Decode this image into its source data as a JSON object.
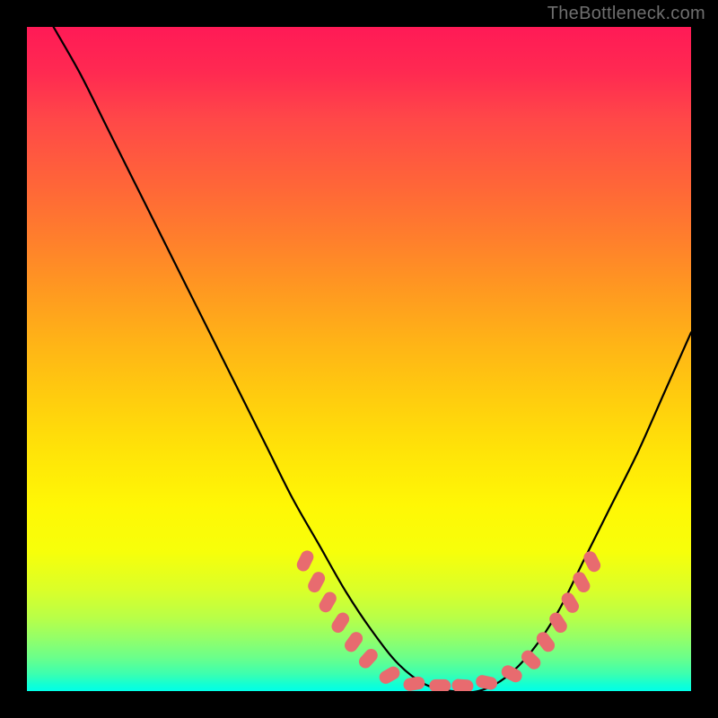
{
  "watermark": "TheBottleneck.com",
  "colors": {
    "background": "#000000",
    "curve_stroke": "#000000",
    "stadium_fill": "#e86b6f",
    "gradient_top": "#ff1a56",
    "gradient_bottom": "#00ffe8"
  },
  "chart_data": {
    "type": "line",
    "title": "",
    "xlabel": "",
    "ylabel": "",
    "xlim": [
      0,
      100
    ],
    "ylim": [
      0,
      100
    ],
    "x": [
      4,
      8,
      12,
      16,
      20,
      24,
      28,
      32,
      36,
      40,
      44,
      48,
      52,
      56,
      60,
      64,
      68,
      72,
      76,
      80,
      84,
      88,
      92,
      96,
      100
    ],
    "values": [
      100,
      93,
      85,
      77,
      69,
      61,
      53,
      45,
      37,
      29,
      22,
      15,
      9,
      4,
      1,
      0,
      0,
      2,
      6,
      12,
      20,
      28,
      36,
      45,
      54
    ],
    "annotation_stadiums": [
      {
        "cx": 41.9,
        "cy": 80.4,
        "tilt": -64
      },
      {
        "cx": 43.6,
        "cy": 83.6,
        "tilt": -62
      },
      {
        "cx": 45.3,
        "cy": 86.6,
        "tilt": -60
      },
      {
        "cx": 47.2,
        "cy": 89.7,
        "tilt": -57
      },
      {
        "cx": 49.2,
        "cy": 92.6,
        "tilt": -54
      },
      {
        "cx": 51.4,
        "cy": 95.1,
        "tilt": -48
      },
      {
        "cx": 54.6,
        "cy": 97.6,
        "tilt": -30
      },
      {
        "cx": 58.3,
        "cy": 98.9,
        "tilt": -10
      },
      {
        "cx": 62.2,
        "cy": 99.2,
        "tilt": 0
      },
      {
        "cx": 65.6,
        "cy": 99.2,
        "tilt": 4
      },
      {
        "cx": 69.2,
        "cy": 98.7,
        "tilt": 12
      },
      {
        "cx": 73.0,
        "cy": 97.4,
        "tilt": 28
      },
      {
        "cx": 75.9,
        "cy": 95.3,
        "tilt": 44
      },
      {
        "cx": 78.1,
        "cy": 92.6,
        "tilt": 53
      },
      {
        "cx": 80.0,
        "cy": 89.7,
        "tilt": 57
      },
      {
        "cx": 81.8,
        "cy": 86.7,
        "tilt": 59
      },
      {
        "cx": 83.5,
        "cy": 83.6,
        "tilt": 61
      },
      {
        "cx": 85.1,
        "cy": 80.5,
        "tilt": 63
      }
    ]
  }
}
